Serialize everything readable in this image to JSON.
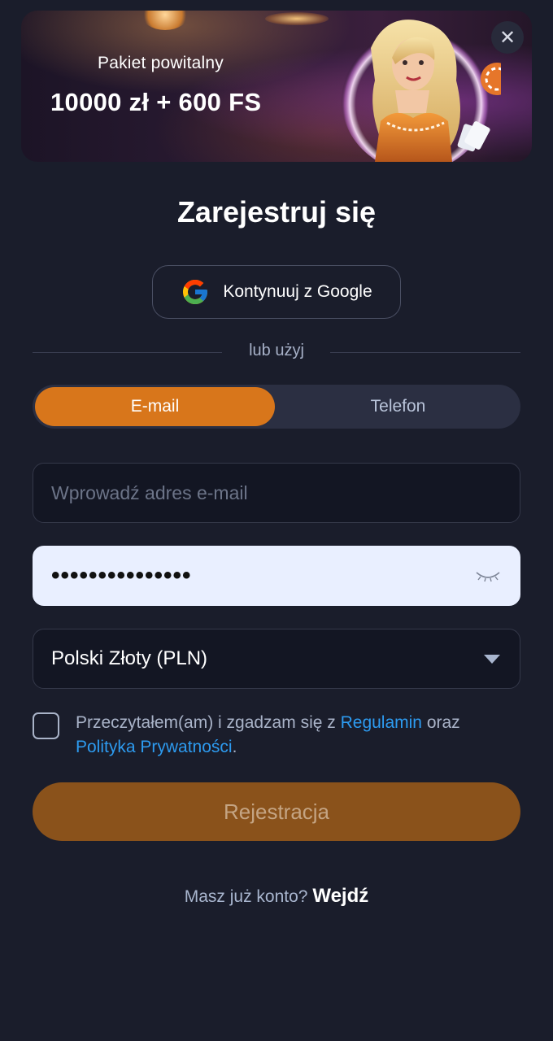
{
  "banner": {
    "subtitle": "Pakiet powitalny",
    "offer": "10000 zł + 600 FS",
    "close_icon": "close-icon"
  },
  "title": "Zarejestruj się",
  "google": {
    "label": "Kontynuuj z Google",
    "icon": "google-logo-icon"
  },
  "divider_text": "lub użyj",
  "tabs": [
    {
      "label": "E-mail",
      "active": true
    },
    {
      "label": "Telefon",
      "active": false
    }
  ],
  "email": {
    "placeholder": "Wprowadź adres e-mail",
    "value": ""
  },
  "password": {
    "masked_value": "•••••••••••••••",
    "toggle_icon": "eye-closed-icon"
  },
  "currency": {
    "selected": "Polski Złoty (PLN)",
    "icon": "caret-down-icon"
  },
  "agreement": {
    "prefix": "Przeczytałem(am) i zgadzam się z ",
    "terms_link": "Regulamin",
    "middle": " oraz ",
    "privacy_link": "Polityka Prywatności",
    "suffix": ".",
    "checked": false
  },
  "register_label": "Rejestracja",
  "login": {
    "prompt": "Masz już konto?",
    "link": "Wejdź"
  },
  "colors": {
    "background": "#1a1d2b",
    "accent": "#d8761b",
    "register_disabled": "#8a521b",
    "link": "#2d9bf0"
  }
}
